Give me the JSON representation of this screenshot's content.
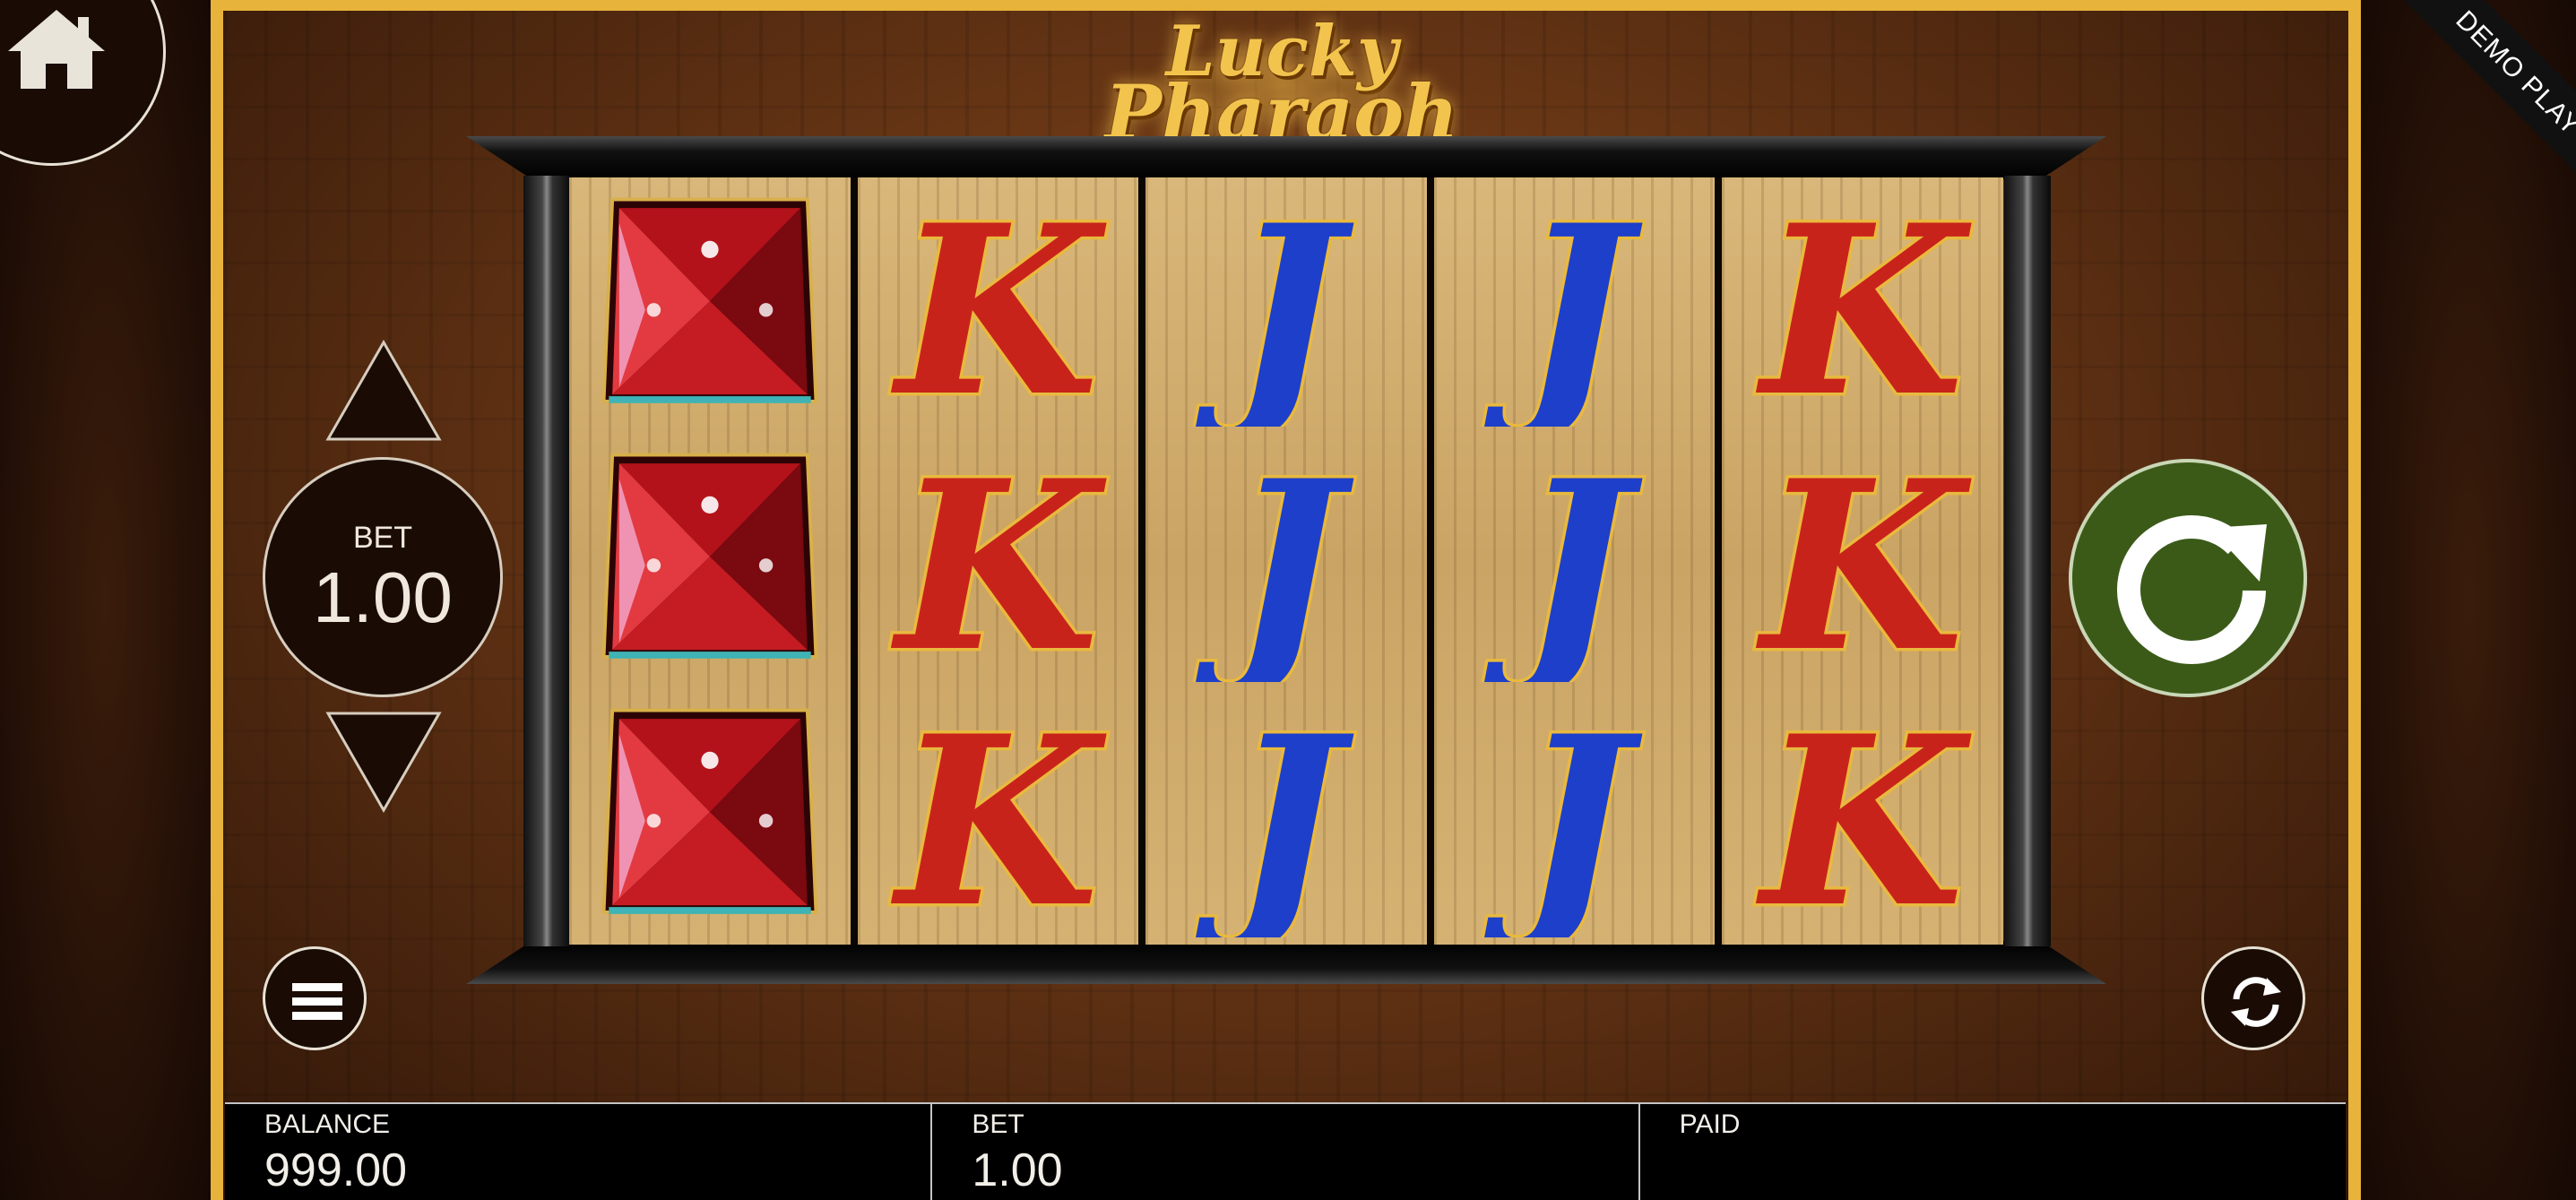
{
  "game": {
    "title_line1": "Lucky",
    "title_line2": "Pharaoh",
    "ribbon": "DEMO PLAY"
  },
  "bet_control": {
    "label": "BET",
    "value": "1.00"
  },
  "reels": [
    [
      "red-gem",
      "red-gem",
      "red-gem"
    ],
    [
      "K",
      "K",
      "K"
    ],
    [
      "J",
      "J",
      "J"
    ],
    [
      "J",
      "J",
      "J"
    ],
    [
      "K",
      "K",
      "K"
    ]
  ],
  "footer": {
    "balance_label": "BALANCE",
    "balance_value": "999.00",
    "bet_label": "BET",
    "bet_value": "1.00",
    "paid_label": "PAID",
    "paid_value": ""
  },
  "icons": {
    "home": "home-icon",
    "menu": "menu-icon",
    "spin": "spin-icon",
    "autoplay": "autoplay-icon"
  },
  "colors": {
    "frame_gold": "#e7b33a",
    "spin_green": "#3b5a18",
    "k_red": "#c8231b",
    "j_blue": "#1d3fc9"
  }
}
